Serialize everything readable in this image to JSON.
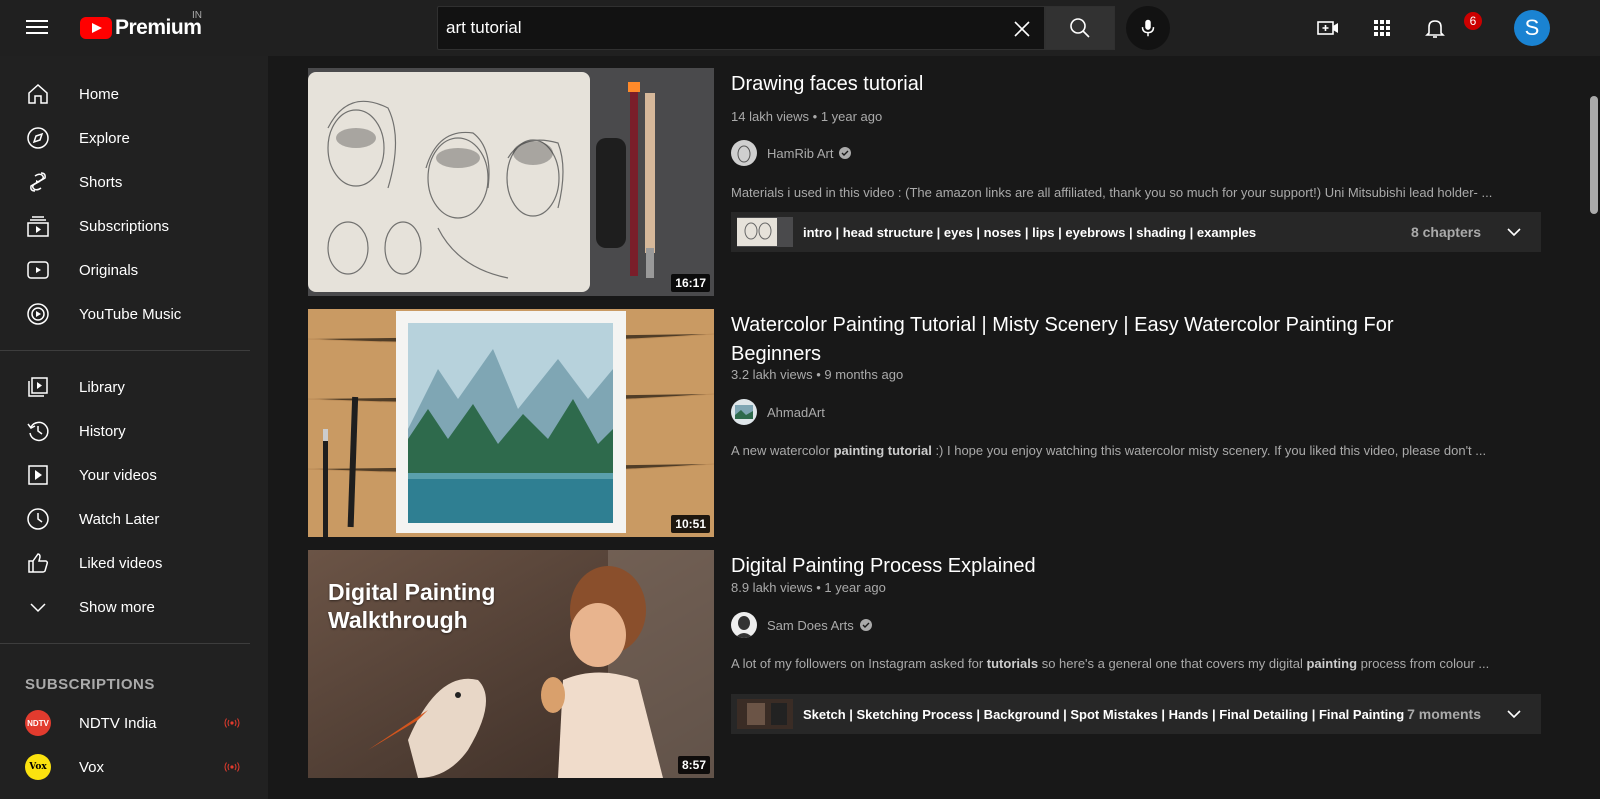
{
  "header": {
    "logo_text": "Premium",
    "country_code": "IN",
    "search_value": "art tutorial",
    "search_placeholder": "Search",
    "notification_count": "6",
    "avatar_letter": "S"
  },
  "sidebar": {
    "primary": [
      {
        "label": "Home",
        "icon": "home-icon"
      },
      {
        "label": "Explore",
        "icon": "compass-icon"
      },
      {
        "label": "Shorts",
        "icon": "shorts-icon"
      },
      {
        "label": "Subscriptions",
        "icon": "subscriptions-icon"
      },
      {
        "label": "Originals",
        "icon": "originals-icon"
      },
      {
        "label": "YouTube Music",
        "icon": "music-icon"
      }
    ],
    "secondary": [
      {
        "label": "Library",
        "icon": "library-icon"
      },
      {
        "label": "History",
        "icon": "history-icon"
      },
      {
        "label": "Your videos",
        "icon": "your-videos-icon"
      },
      {
        "label": "Watch Later",
        "icon": "clock-icon"
      },
      {
        "label": "Liked videos",
        "icon": "thumbs-up-icon"
      },
      {
        "label": "Show more",
        "icon": "chevron-down-icon"
      }
    ],
    "subscriptions_title": "SUBSCRIPTIONS",
    "subscriptions": [
      {
        "label": "NDTV India",
        "avatar_text": "NDTV",
        "avatar_color": "#e23b2e"
      },
      {
        "label": "Vox",
        "avatar_text": "Vox",
        "avatar_color": "#fbe20f"
      }
    ]
  },
  "results": [
    {
      "title": "Drawing faces tutorial",
      "meta": "14 lakh views • 1 year ago",
      "channel": "HamRib Art",
      "verified": true,
      "description": "Materials i used in this video : (The amazon links are all affiliated, thank you so much for your support!) Uni Mitsubishi lead holder- ...",
      "duration": "16:17",
      "chapters_text": "intro | head structure | eyes | noses | lips | eyebrows | shading | examples",
      "chapters_count": "8 chapters"
    },
    {
      "title": "Watercolor Painting Tutorial | Misty Scenery | Easy Watercolor Painting For Beginners",
      "meta": "3.2 lakh views • 9 months ago",
      "channel": "AhmadArt",
      "verified": false,
      "description_parts": [
        "A new watercolor ",
        "painting tutorial",
        " :) I hope you enjoy watching this watercolor misty scenery. If you liked this video, please don't ..."
      ],
      "duration": "10:51"
    },
    {
      "title": "Digital Painting Process Explained",
      "meta": "8.9 lakh views • 1 year ago",
      "channel": "Sam Does Arts",
      "verified": true,
      "description_parts": [
        "A lot of my followers on Instagram asked for ",
        "tutorials",
        " so here's a general one that covers my digital ",
        "painting",
        " process from colour ..."
      ],
      "thumb_caption_line1": "Digital Painting",
      "thumb_caption_line2": "Walkthrough",
      "duration": "8:57",
      "chapters_text": "Sketch | Sketching Process | Background | Spot Mistakes | Hands | Final Detailing | Final Painting",
      "chapters_count": "7 moments"
    }
  ],
  "colors": {
    "brand_red": "#ff0000",
    "avatar_blue": "#1a83d2",
    "badge_red": "#cc0000",
    "live_red": "#e23b2e"
  }
}
